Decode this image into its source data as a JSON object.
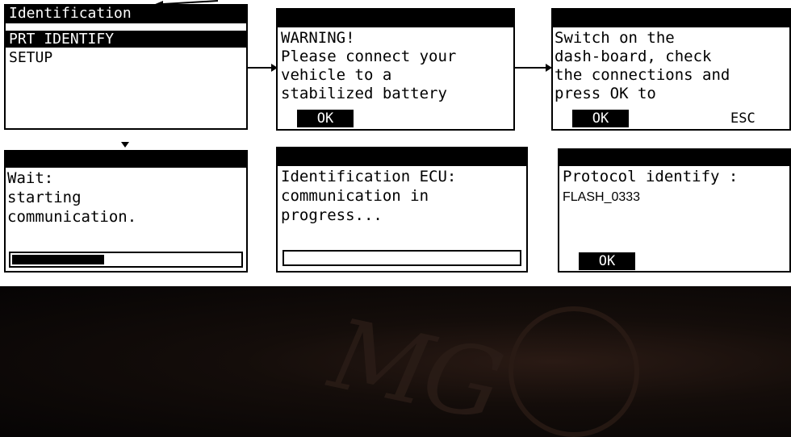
{
  "screens": {
    "identification": {
      "title": "Identification",
      "menu": [
        "PRT IDENTIFY",
        "SETUP"
      ]
    },
    "warning": {
      "lines": [
        "WARNING!",
        "Please connect your",
        "vehicle to a",
        "stabilized battery"
      ],
      "ok_label": "OK"
    },
    "switch_on": {
      "lines": [
        "Switch on the",
        "dash-board, check",
        "the connections and",
        "press OK to"
      ],
      "ok_label": "OK",
      "esc_label": "ESC"
    },
    "wait": {
      "lines": [
        "Wait:",
        "starting",
        "communication."
      ],
      "progress": 0.4
    },
    "identification_ecu": {
      "lines": [
        "Identification ECU:",
        "communication in",
        "progress..."
      ],
      "progress": 0
    },
    "protocol": {
      "line": "Protocol identify :",
      "value": "FLASH_0333",
      "ok_label": "OK"
    }
  }
}
